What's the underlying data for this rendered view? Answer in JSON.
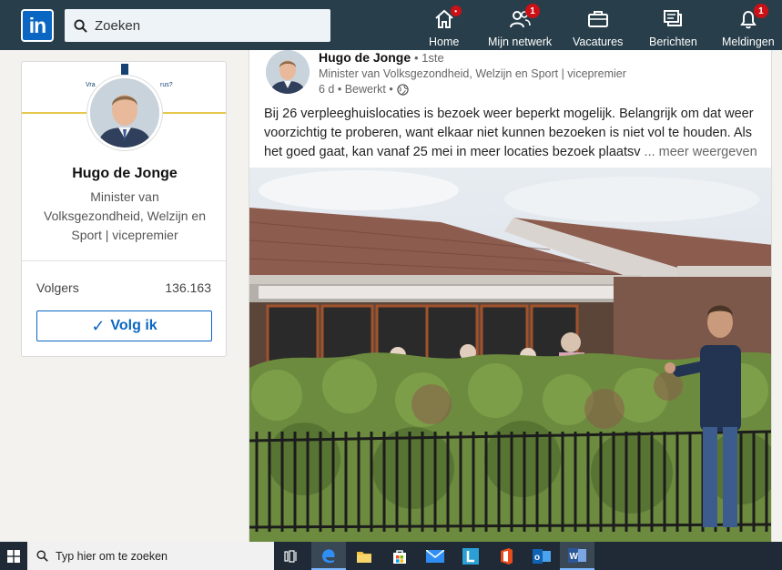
{
  "nav": {
    "logo_text": "in",
    "search_placeholder": "Zoeken",
    "items": [
      {
        "label": "Home",
        "badge": "•"
      },
      {
        "label": "Mijn netwerk",
        "badge": "1"
      },
      {
        "label": "Vacatures",
        "badge": ""
      },
      {
        "label": "Berichten",
        "badge": ""
      },
      {
        "label": "Meldingen",
        "badge": "1"
      }
    ]
  },
  "profile": {
    "name": "Hugo de Jonge",
    "title": "Minister van Volksgezondheid, Welzijn en Sport | vicepremier",
    "followers_label": "Volgers",
    "followers_count": "136.163",
    "follow_button": "Volg ik",
    "cover_text_left": "Vra",
    "cover_text_right": "rus?"
  },
  "post": {
    "author": "Hugo de Jonge",
    "degree": "• 1ste",
    "author_title": "Minister van Volksgezondheid, Welzijn en Sport | vicepremier",
    "meta": "6 d • Bewerkt •",
    "text": "Bij 26 verpleeghuislocaties is bezoek weer beperkt mogelijk. Belangrijk om dat weer voorzichtig te proberen, want elkaar niet kunnen bezoeken is niet vol te houden. Als het goed gaat, kan vanaf 25 mei in meer locaties bezoek plaatsv",
    "more": "... meer weergeven"
  },
  "taskbar": {
    "search_placeholder": "Typ hier om te zoeken"
  },
  "colors": {
    "nav_bg": "#283e4a",
    "brand_blue": "#0a66c2",
    "badge_red": "#cc1016"
  }
}
